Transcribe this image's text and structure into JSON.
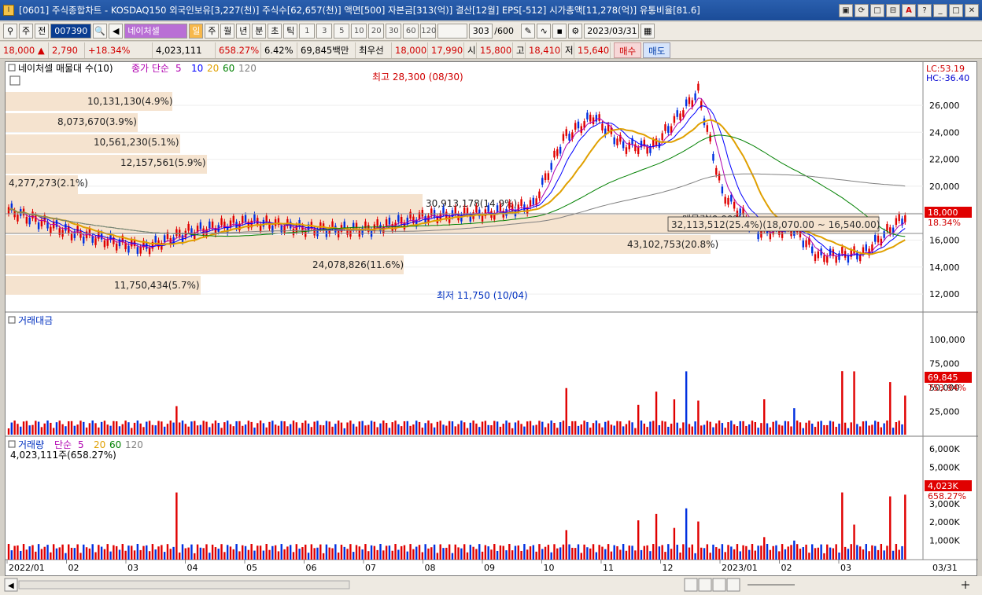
{
  "window": {
    "title": "[0601] 주식종합차트 - KOSDAQ150 외국인보유[3,227(천)] 주식수[62,657(천)] 액면[500] 자본금[313(억)] 결산[12월] EPS[-512] 시가총액[11,278(억)] 유통비율[81.6]",
    "buttons": [
      "▣",
      "⟳",
      "□",
      "⊟",
      "A",
      "?",
      "_",
      "□",
      "✕"
    ]
  },
  "toolbar": {
    "type_select": "주",
    "prev_label": "전",
    "code": "007390",
    "name": "네이처셀",
    "periods": [
      "일",
      "주",
      "월",
      "년",
      "분",
      "초",
      "틱"
    ],
    "intervals": [
      "1",
      "3",
      "5",
      "10",
      "20",
      "30",
      "60",
      "120"
    ],
    "count": "303",
    "count_max": "/600",
    "date": "2023/03/31"
  },
  "quote": {
    "price": "18,000",
    "change": "2,790",
    "pct": "+18.34%",
    "volume": "4,023,111",
    "vol_pct": "658.27%",
    "turnover": "6.42%",
    "amount": "69,845백만",
    "bid_label": "최우선",
    "bid": "18,000",
    "ask": "17,990",
    "open_label": "시",
    "open": "15,800",
    "high_label": "고",
    "high": "18,410",
    "low_label": "저",
    "low": "15,640",
    "buy_label": "매수",
    "sell_label": "매도"
  },
  "price_panel": {
    "legend_name": "네이처셀 매물대 수(10)",
    "ma_label": "종가 단순",
    "ma_periods": [
      "5",
      "10",
      "20",
      "60",
      "120"
    ],
    "ma_colors": [
      "#b000b0",
      "#0000ff",
      "#e0a000",
      "#008000",
      "#808080"
    ],
    "lc": "LC:53.19",
    "hc": "HC:-36.40",
    "high_note": "최고 28,300 (08/30)",
    "low_note": "최저 11,750 (10/04)",
    "current_price_tag": "18,000",
    "current_pct_tag": "18.34%",
    "box_note": "매물량(0.00%)",
    "range_note": "32,113,512(25.4%)(18,070.00 ~ 16,540.00)",
    "volume_profile_labels": [
      "10,131,130(4.9%)",
      "8,073,670(3.9%)",
      "10,561,230(5.1%)",
      "12,157,561(5.9%)",
      "4,277,273(2.1%)",
      "30,913,178(14.9%)",
      "43,102,753(20.8%)",
      "24,078,826(11.6%)",
      "11,750,434(5.7%)"
    ],
    "yticks": [
      "26,000",
      "24,000",
      "22,000",
      "20,000",
      "18,000",
      "16,000",
      "14,000",
      "12,000"
    ]
  },
  "amount_panel": {
    "legend": "거래대금",
    "yticks": [
      "100,000",
      "75,000",
      "50,000",
      "25,000"
    ],
    "tag_value": "69,845",
    "tag_pct": "753.94%"
  },
  "volume_panel": {
    "legend": "거래량",
    "ma_label": "단순",
    "ma_periods": [
      "5",
      "20",
      "60",
      "120"
    ],
    "value_note": "4,023,111주(658.27%)",
    "yticks": [
      "6,000K",
      "5,000K",
      "4,000K",
      "3,000K",
      "2,000K",
      "1,000K"
    ],
    "tag_value": "4,023K",
    "tag_pct": "658.27%"
  },
  "xaxis": {
    "labels": [
      "2022/01",
      "02",
      "03",
      "04",
      "05",
      "06",
      "07",
      "08",
      "09",
      "10",
      "11",
      "12",
      "2023/01",
      "02",
      "03"
    ],
    "end_label": "03/31"
  }
}
